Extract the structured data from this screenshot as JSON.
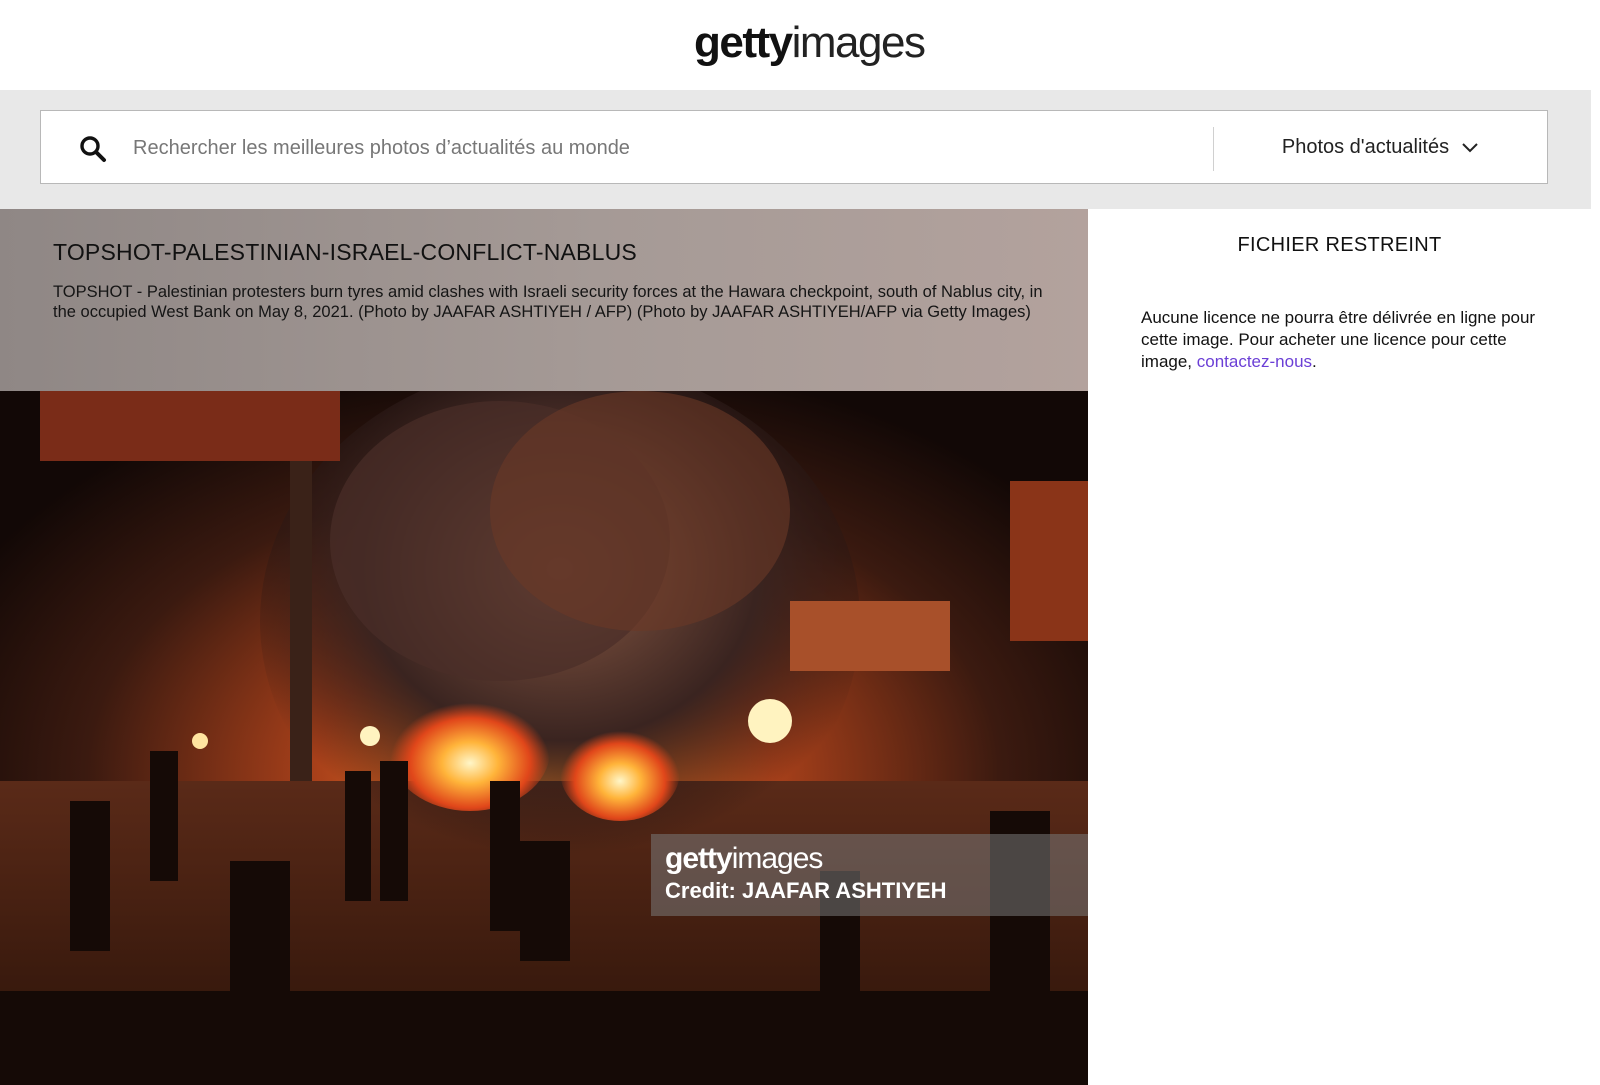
{
  "header": {
    "logo_bold": "getty",
    "logo_light": "images"
  },
  "search": {
    "placeholder": "Rechercher les meilleures photos d’actualités au monde",
    "category_label": "Photos d'actualités"
  },
  "caption": {
    "title": "TOPSHOT-PALESTINIAN-ISRAEL-CONFLICT-NABLUS",
    "text": "TOPSHOT - Palestinian protesters burn tyres amid clashes with Israeli security forces at the Hawara checkpoint, south of Nablus city, in the occupied West Bank on May 8, 2021. (Photo by JAAFAR ASHTIYEH / AFP) (Photo by JAAFAR ASHTIYEH/AFP via Getty Images)"
  },
  "watermark": {
    "logo_bold": "getty",
    "logo_light": "images",
    "credit": "Credit: JAAFAR ASHTIYEH"
  },
  "license": {
    "title": "FICHIER RESTREINT",
    "text_before": "Aucune licence ne pourra être délivrée en ligne pour cette image. Pour acheter une licence pour cette image, ",
    "link": "contactez-nous",
    "text_after": "."
  },
  "colors": {
    "link": "#6b3fd6",
    "search_band": "#e8e8e8",
    "caption_panel": "#a59a96"
  },
  "icons": [
    "search-icon",
    "chevron-down-icon"
  ]
}
